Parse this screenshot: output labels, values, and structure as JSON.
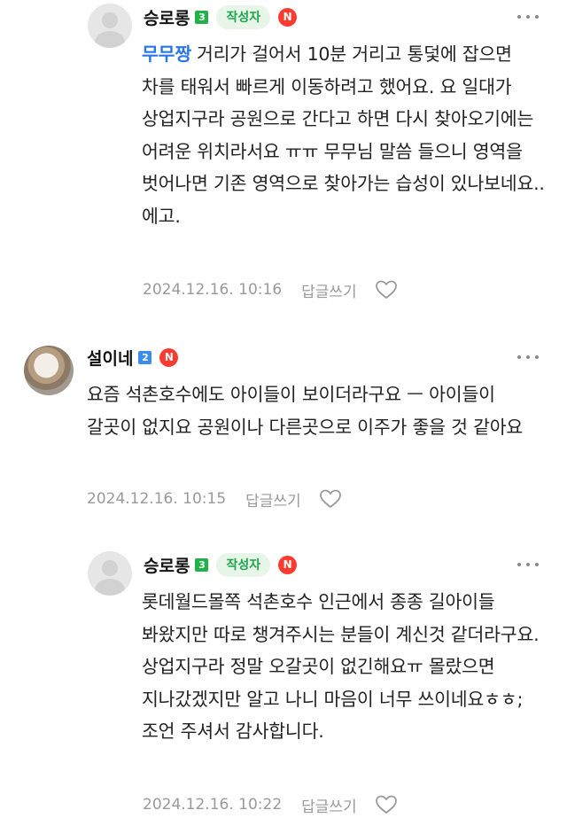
{
  "comments": [
    {
      "author": "승로롱",
      "level": "3",
      "level_color": "#20b14a",
      "author_badge": "작성자",
      "new_badge": "N",
      "mention": "무무짱",
      "text": "거리가 걸어서 10분 거리고 통덫에 잡으면 차를 태워서 빠르게 이동하려고 했어요. 요 일대가 상업지구라 공원으로 간다고 하면 다시 찾아오기에는 어려운 위치라서요 ㅠㅠ 무무님 말씀 들으니 영역을 벗어나면 기존 영역으로 찾아가는 습성이 있나보네요.. 에고.",
      "timestamp": "2024.12.16. 10:16",
      "reply_label": "답글쓰기",
      "avatar_icon": "default-profile-icon"
    },
    {
      "author": "설이네",
      "level": "2",
      "level_color": "#3a8df0",
      "new_badge": "N",
      "text": "요즘 석촌호수에도 아이들이 보이더라구요 ㅡ 아이들이 갈곳이 없지요 공원이나 다른곳으로 이주가 좋을 것 같아요",
      "timestamp": "2024.12.16. 10:15",
      "reply_label": "답글쓰기",
      "avatar_icon": "cat-photo-avatar"
    },
    {
      "author": "승로롱",
      "level": "3",
      "level_color": "#20b14a",
      "author_badge": "작성자",
      "new_badge": "N",
      "text": "롯데월드몰쪽 석촌호수 인근에서 종종 길아이들 봐왔지만 따로 챙겨주시는 분들이 계신것 같더라구요. 상업지구라 정말 오갈곳이 없긴해요ㅠ 몰랐으면 지나갔겠지만 알고 나니 마음이 너무 쓰이네요ㅎㅎ; 조언 주셔서 감사합니다.",
      "timestamp": "2024.12.16. 10:22",
      "reply_label": "답글쓰기",
      "avatar_icon": "default-profile-icon"
    }
  ],
  "icons": {
    "more": "more-dots-icon",
    "like": "heart-icon"
  }
}
